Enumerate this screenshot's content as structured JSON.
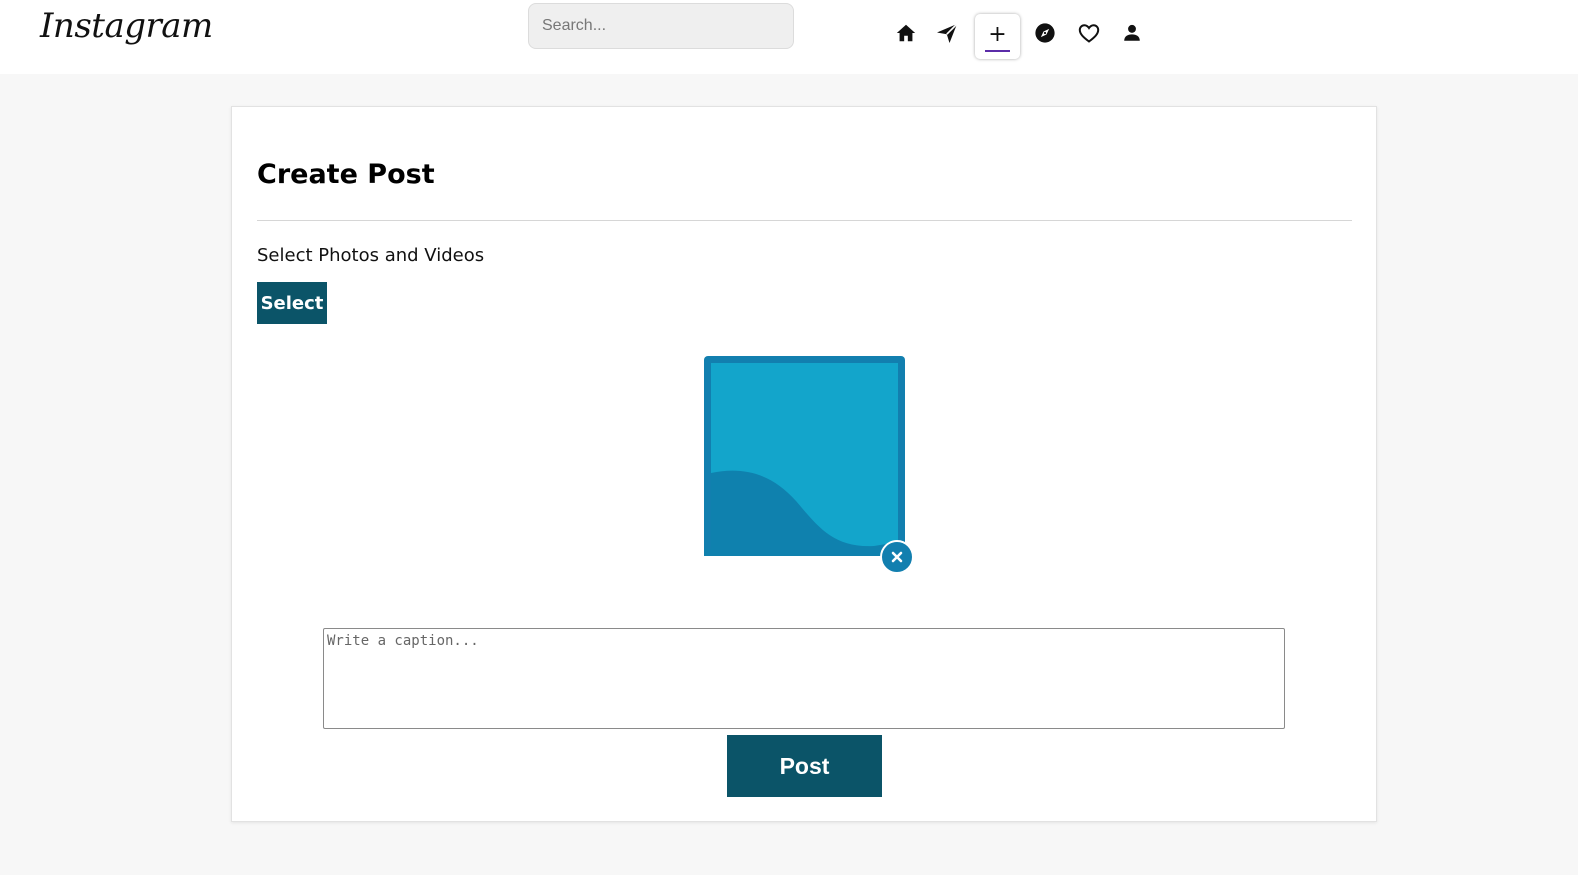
{
  "header": {
    "logo_text": "Instagram",
    "search": {
      "placeholder": "Search...",
      "value": ""
    },
    "nav": [
      {
        "icon": "home-icon"
      },
      {
        "icon": "send-icon"
      },
      {
        "icon": "plus-icon",
        "label": "+",
        "active": true
      },
      {
        "icon": "explore-icon"
      },
      {
        "icon": "heart-icon"
      },
      {
        "icon": "profile-icon"
      }
    ],
    "active_accent": "#5b2ca8"
  },
  "create_post": {
    "title": "Create Post",
    "select_label": "Select Photos and Videos",
    "select_button": "Select",
    "preview": {
      "icon": "image-placeholder-icon",
      "remove_icon": "close-icon"
    },
    "caption": {
      "placeholder": "Write a caption...",
      "value": ""
    },
    "post_button": "Post"
  },
  "colors": {
    "button_bg": "#0b5468",
    "image_frame": "#127faf",
    "image_fill": "#13a5cb",
    "image_wave": "#0f81ae"
  }
}
